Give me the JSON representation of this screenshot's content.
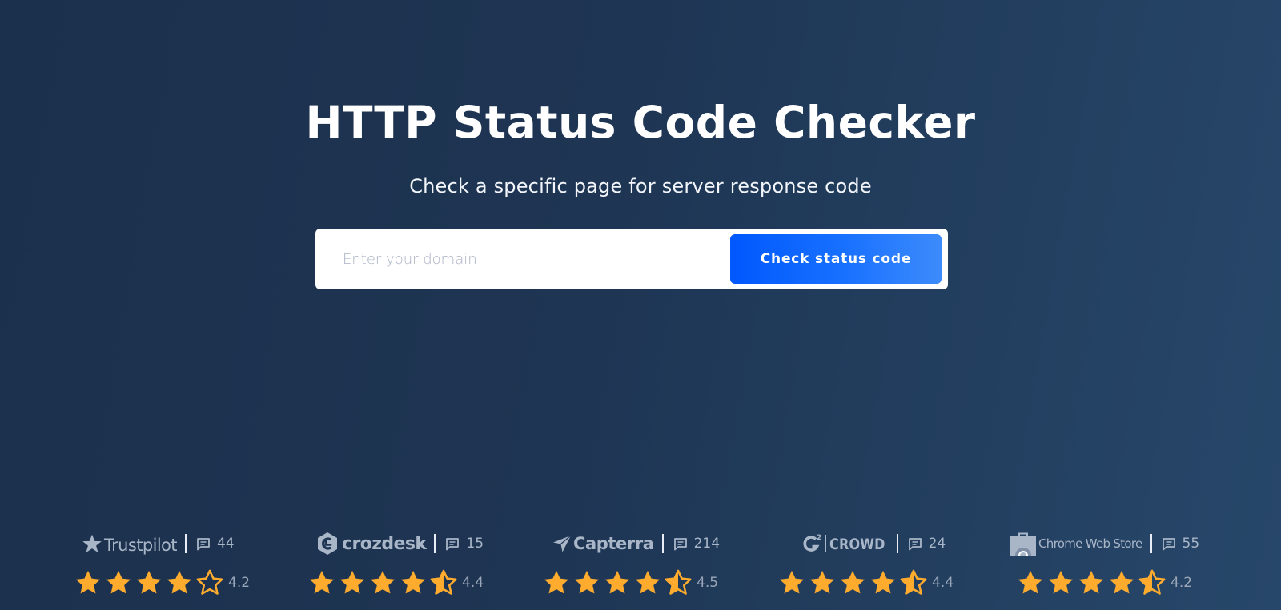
{
  "header": {
    "title": "HTTP Status Code Checker",
    "subtitle": "Check a specific page for server response code"
  },
  "search": {
    "placeholder": "Enter your domain",
    "value": "",
    "button_label": "Check status code"
  },
  "colors": {
    "star": "#ffab2e",
    "button_start": "#0058fe",
    "button_end": "#3d8bfb",
    "muted": "#a9b6c8"
  },
  "reviews": [
    {
      "platform": "Trustpilot",
      "icon": "trustpilot-star-icon",
      "count": "44",
      "rating": "4.2",
      "stars": [
        1,
        1,
        1,
        1,
        0
      ]
    },
    {
      "platform": "crozdesk",
      "icon": "crozdesk-logo-icon",
      "count": "15",
      "rating": "4.4",
      "stars": [
        1,
        1,
        1,
        1,
        0.5
      ]
    },
    {
      "platform": "Capterra",
      "icon": "capterra-arrow-icon",
      "count": "214",
      "rating": "4.5",
      "stars": [
        1,
        1,
        1,
        1,
        0.5
      ]
    },
    {
      "platform": "CROWD",
      "logo_prefix": "G2",
      "icon": "g2-logo-icon",
      "count": "24",
      "rating": "4.4",
      "stars": [
        1,
        1,
        1,
        1,
        0.5
      ]
    },
    {
      "platform": "Chrome Web Store",
      "icon": "chrome-web-store-icon",
      "count": "55",
      "rating": "4.2",
      "stars": [
        1,
        1,
        1,
        1,
        0.5
      ]
    }
  ]
}
